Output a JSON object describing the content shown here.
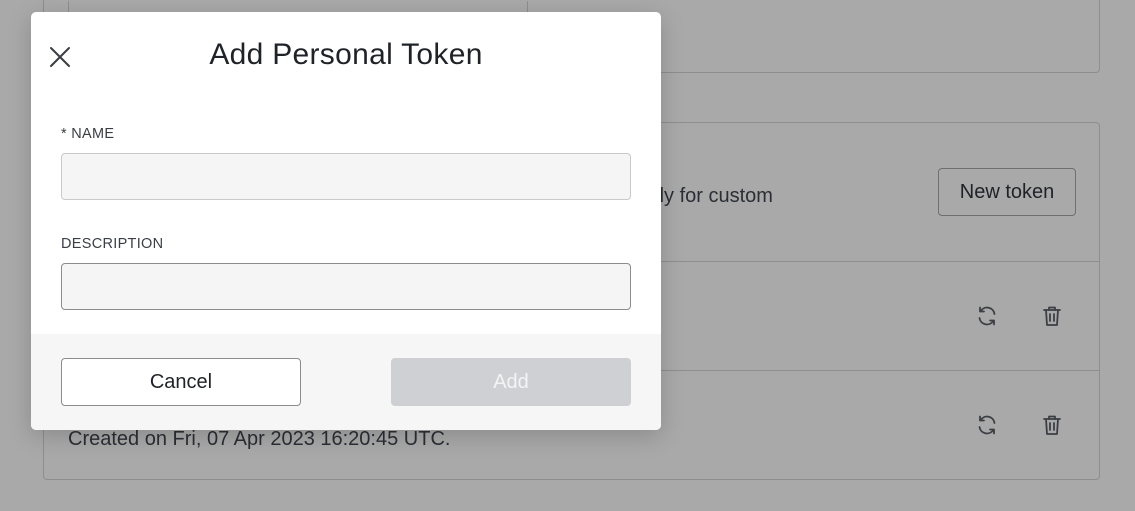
{
  "background": {
    "description_fragment": "ally for custom",
    "new_token_label": "New token",
    "created_text": "Created on Fri, 07 Apr 2023 16:20:45 UTC.",
    "row_icons": [
      "refresh-icon",
      "trash-icon"
    ]
  },
  "modal": {
    "title": "Add Personal Token",
    "close_icon": "close-icon",
    "fields": {
      "name": {
        "label": "* NAME",
        "value": "",
        "placeholder": ""
      },
      "description": {
        "label": "DESCRIPTION",
        "value": "",
        "placeholder": ""
      }
    },
    "buttons": {
      "cancel": "Cancel",
      "add": "Add"
    }
  },
  "colors": {
    "overlay_bg": "#a9a9a9",
    "modal_bg": "#ffffff",
    "footer_bg": "#f6f6f6",
    "add_disabled_bg": "#cfd0d4",
    "add_disabled_text": "#f4f4f6"
  }
}
